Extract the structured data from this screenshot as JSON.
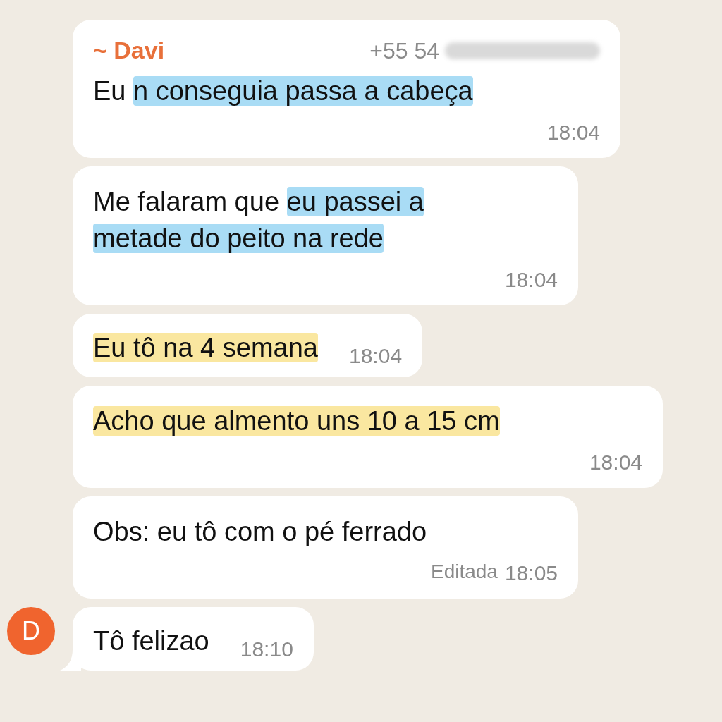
{
  "messages": [
    {
      "sender": "~ Davi",
      "phone": "+55 54",
      "redacted": true,
      "segments": [
        {
          "text": "Eu ",
          "highlighted": false
        },
        {
          "text": "n conseguia passa a cabeça",
          "highlighted": true,
          "color": "#a9dcf5"
        }
      ],
      "time_inline": false,
      "time": "18:04"
    },
    {
      "segments": [
        {
          "text": "Me falaram que ",
          "highlighted": false
        },
        {
          "text": "eu passei a metade do peito na rede",
          "highlighted": true,
          "color": "#a9dcf5"
        }
      ],
      "time_inline": false,
      "time": "18:04"
    },
    {
      "segments": [
        {
          "text": "Eu tô na 4 semana",
          "highlighted": true,
          "color": "#fae7a0"
        }
      ],
      "time_inline": true,
      "time": "18:04"
    },
    {
      "segments": [
        {
          "text": "Acho que almento uns 10 a 15 cm",
          "highlighted": true,
          "color": "#fae7a0"
        }
      ],
      "time_inline": false,
      "time": "18:04"
    },
    {
      "segments": [
        {
          "text": "Obs: eu tô com o pé ferrado",
          "highlighted": false
        }
      ],
      "time_inline": false,
      "edited": "Editada",
      "time": "18:05"
    },
    {
      "avatar": "D",
      "tail": true,
      "segments": [
        {
          "text": "Tô felizao",
          "highlighted": false
        }
      ],
      "time_inline": true,
      "time": "18:10"
    }
  ]
}
